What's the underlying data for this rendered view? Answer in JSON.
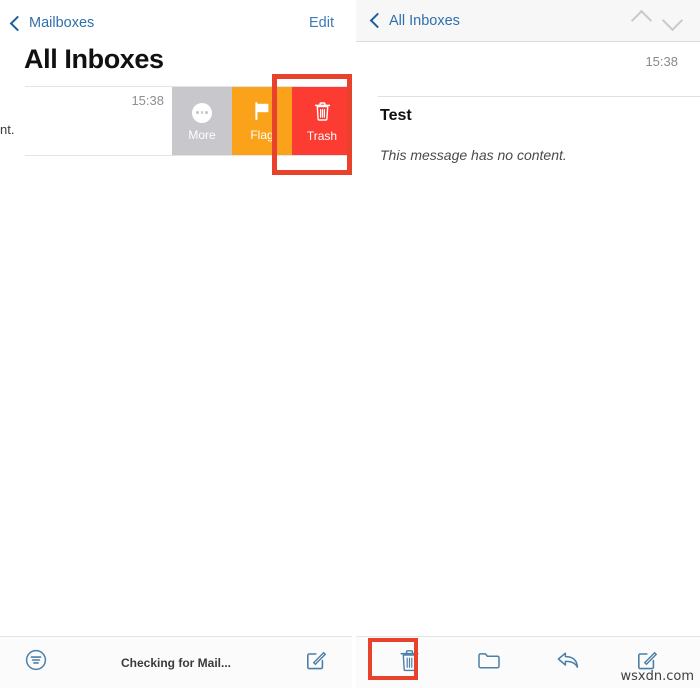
{
  "left_panel": {
    "nav": {
      "back_label": "Mailboxes",
      "back_icon": "chevron-left-icon",
      "edit_label": "Edit"
    },
    "title": "All Inboxes",
    "ghost_text_fragment": "nt.",
    "row": {
      "time": "15:38",
      "disclosure_icon": "chevron-right-icon"
    },
    "swipe_actions": [
      {
        "label": "More",
        "icon": "more-dots-icon",
        "color": "#c7c7cc"
      },
      {
        "label": "Flag",
        "icon": "flag-icon",
        "color": "#f9a21a"
      },
      {
        "label": "Trash",
        "icon": "trash-icon",
        "color": "#fc3b33"
      }
    ],
    "toolbar": {
      "filter_icon": "filter-circle-icon",
      "status_text": "Checking for Mail...",
      "compose_icon": "compose-icon"
    }
  },
  "right_panel": {
    "nav": {
      "back_label": "All Inboxes",
      "back_icon": "chevron-left-icon",
      "prev_icon": "chevron-up-icon",
      "next_icon": "chevron-down-icon"
    },
    "message": {
      "time": "15:38",
      "subject": "Test",
      "body": "This message has no content."
    },
    "toolbar": {
      "items": [
        {
          "icon": "trash-icon",
          "name": "delete"
        },
        {
          "icon": "folder-icon",
          "name": "move"
        },
        {
          "icon": "reply-icon",
          "name": "reply"
        },
        {
          "icon": "compose-icon",
          "name": "compose"
        }
      ]
    }
  },
  "annotations": {
    "highlight_color": "#e8412c",
    "highlight_targets": [
      "swipe-trash-button",
      "toolbar-trash-button"
    ]
  },
  "watermark": "wsxdn.com"
}
